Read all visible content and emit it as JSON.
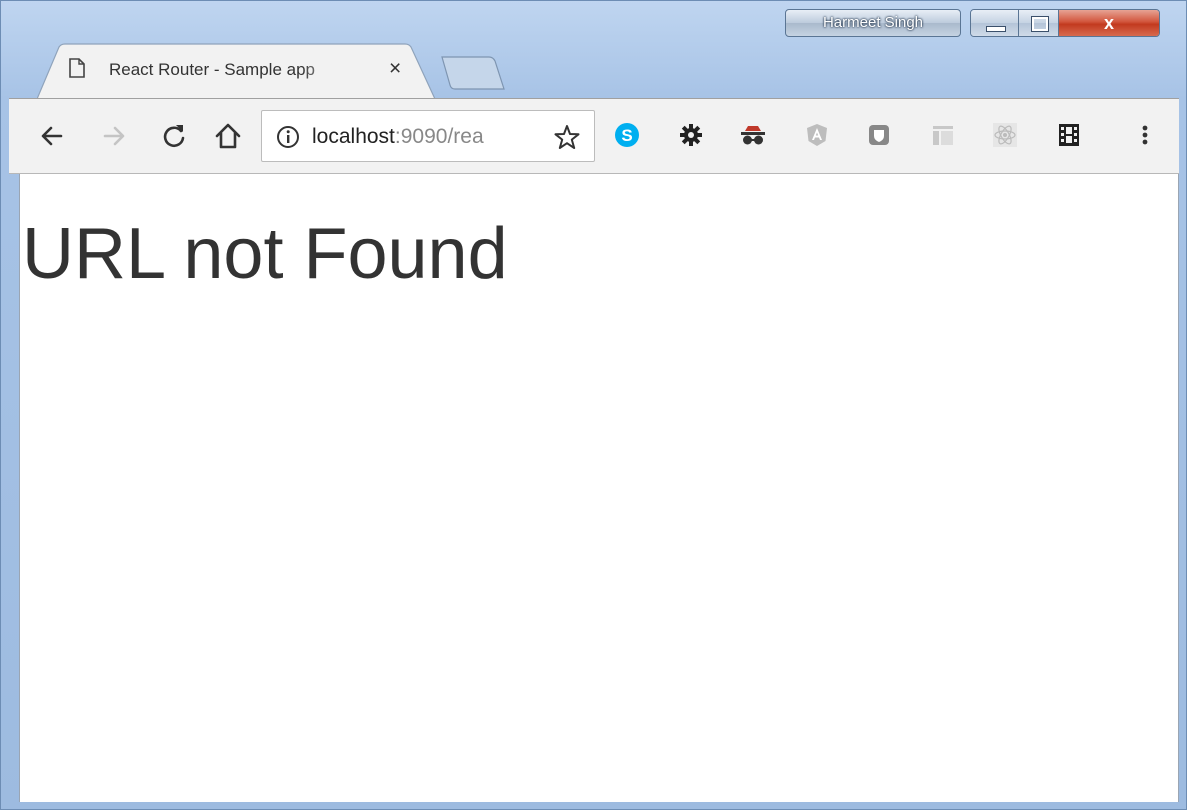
{
  "window": {
    "profile_name": "Harmeet Singh",
    "close_glyph": "x"
  },
  "tabs": [
    {
      "title": "React Router - Sample app",
      "close_glyph": "×",
      "icon": "page-icon"
    }
  ],
  "toolbar": {
    "back_icon": "back-arrow-icon",
    "forward_icon": "forward-arrow-icon",
    "reload_icon": "reload-icon",
    "home_icon": "home-icon",
    "url_host": "localhost",
    "url_rest": ":9090/rea",
    "info_icon": "info-icon",
    "bookmark_icon": "star-icon",
    "extensions": [
      "skype-icon",
      "gear-icon",
      "incognito-glasses-icon",
      "angular-icon",
      "shield-icon",
      "table-icon",
      "react-icon",
      "film-icon"
    ],
    "menu_icon": "kebab-menu-icon"
  },
  "page": {
    "heading": "URL not Found"
  },
  "colors": {
    "skype": "#00aff0",
    "text": "#333333"
  }
}
